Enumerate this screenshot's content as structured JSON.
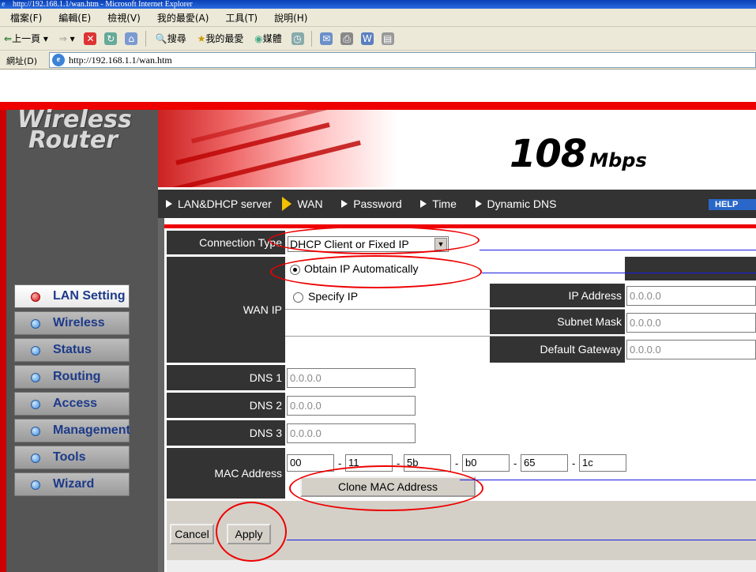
{
  "window": {
    "title": "http://192.168.1.1/wan.htm - Microsoft Internet Explorer"
  },
  "menubar": [
    "檔案(F)",
    "編輯(E)",
    "檢視(V)",
    "我的最愛(A)",
    "工具(T)",
    "說明(H)"
  ],
  "toolbar": {
    "back": "上一頁",
    "search": "搜尋",
    "favorites": "我的最愛",
    "media": "媒體"
  },
  "address": {
    "label": "網址(D)",
    "url": "http://192.168.1.1/wan.htm"
  },
  "brand": {
    "line1": "Wireless",
    "line2": "Router"
  },
  "banner": {
    "speed": "108",
    "unit": "Mbps"
  },
  "nav": [
    {
      "label": "LAN&DHCP server"
    },
    {
      "label": "WAN"
    },
    {
      "label": "Password"
    },
    {
      "label": "Time"
    },
    {
      "label": "Dynamic DNS"
    }
  ],
  "help_label": "HELP",
  "sidebar": [
    {
      "label": "LAN Setting"
    },
    {
      "label": "Wireless"
    },
    {
      "label": "Status"
    },
    {
      "label": "Routing"
    },
    {
      "label": "Access"
    },
    {
      "label": "Management"
    },
    {
      "label": "Tools"
    },
    {
      "label": "Wizard"
    }
  ],
  "form": {
    "connection_type_label": "Connection Type",
    "connection_type_value": "DHCP Client or Fixed IP",
    "wan_ip_label": "WAN IP",
    "obtain_ip_label": "Obtain IP Automatically",
    "specify_ip_label": "Specify IP",
    "ip_address_label": "IP Address",
    "ip_address_value": "0.0.0.0",
    "subnet_mask_label": "Subnet Mask",
    "subnet_mask_value": "0.0.0.0",
    "default_gateway_label": "Default Gateway",
    "default_gateway_value": "0.0.0.0",
    "dns1_label": "DNS 1",
    "dns1_value": "0.0.0.0",
    "dns2_label": "DNS 2",
    "dns2_value": "0.0.0.0",
    "dns3_label": "DNS 3",
    "dns3_value": "0.0.0.0",
    "mac_label": "MAC Address",
    "mac_octets": [
      "00",
      "11",
      "5b",
      "b0",
      "65",
      "1c"
    ],
    "clone_mac_label": "Clone MAC Address",
    "cancel_label": "Cancel",
    "apply_label": "Apply"
  },
  "colors": {
    "accent_red": "#e00000",
    "nav_dark": "#333333",
    "annotation": "#e00000",
    "pointer_line": "#1a1ae0"
  }
}
